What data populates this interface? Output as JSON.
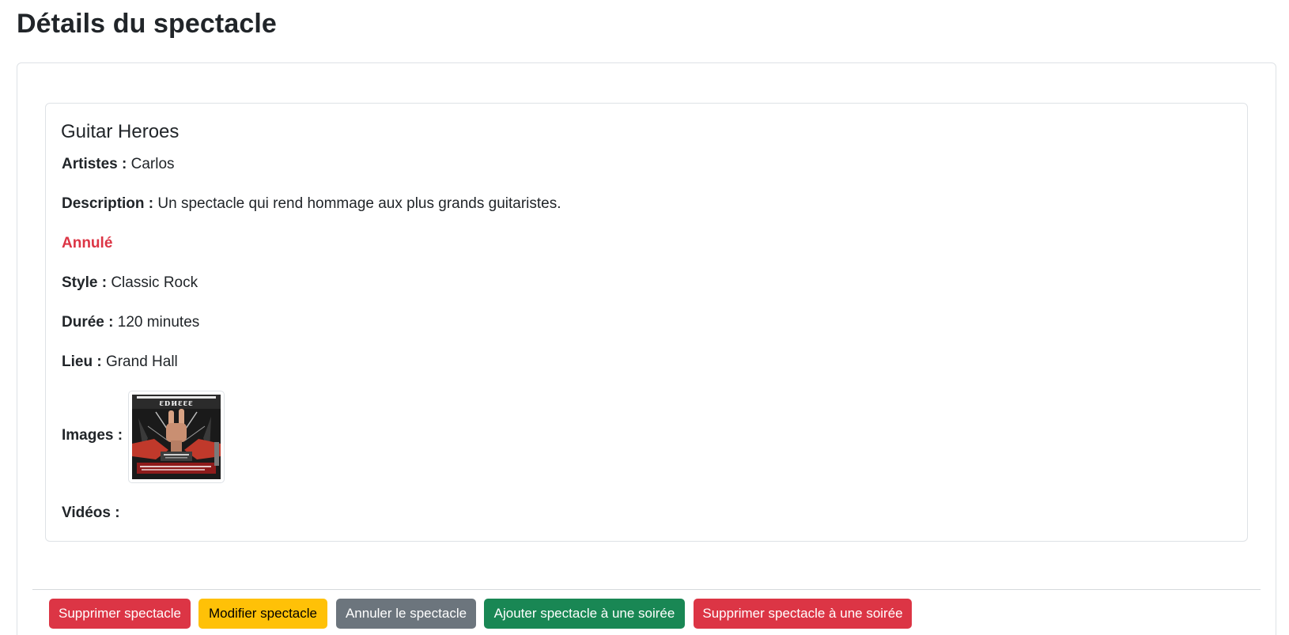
{
  "page": {
    "title": "Détails du spectacle"
  },
  "show": {
    "title": "Guitar Heroes",
    "artists_label": "Artistes :",
    "artists_value": "Carlos",
    "description_label": "Description :",
    "description_value": "Un spectacle qui rend hommage aux plus grands guitaristes.",
    "status": "Annulé",
    "style_label": "Style :",
    "style_value": "Classic Rock",
    "duration_label": "Durée :",
    "duration_value": "120 minutes",
    "venue_label": "Lieu :",
    "venue_value": "Grand Hall",
    "images_label": "Images :",
    "videos_label": "Vidéos :"
  },
  "actions": {
    "delete_show": "Supprimer spectacle",
    "edit_show": "Modifier spectacle",
    "cancel_show": "Annuler le spectacle",
    "add_to_evening": "Ajouter spectacle à une soirée",
    "remove_from_evening": "Supprimer spectacle à une soirée"
  },
  "colors": {
    "danger": "#dc3545",
    "warning": "#ffc107",
    "secondary": "#6c757d",
    "success": "#198754",
    "text": "#212529",
    "border": "#dee2e6"
  }
}
